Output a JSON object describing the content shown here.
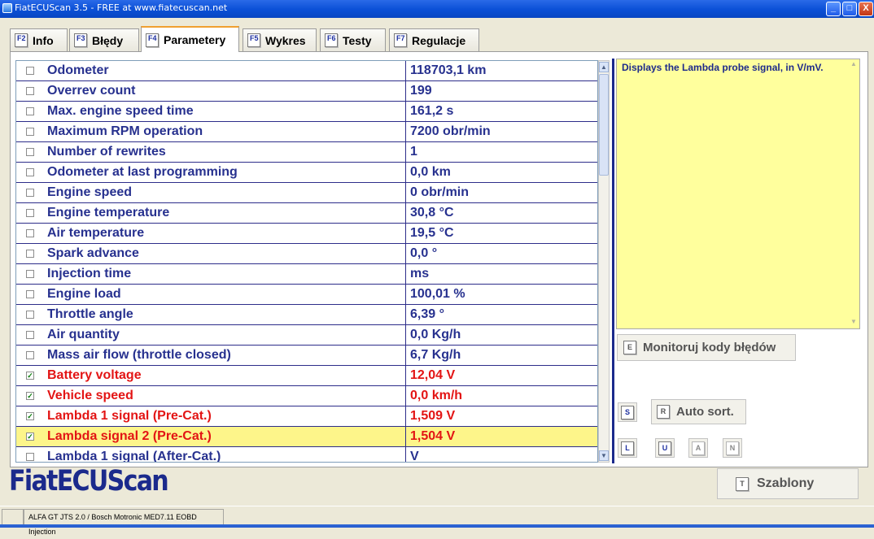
{
  "window": {
    "title": "FiatECUScan 3.5 - FREE at www.fiatecuscan.net",
    "controls": {
      "minimize": "_",
      "maximize": "□",
      "close": "X"
    }
  },
  "tabs": [
    {
      "key": "F2",
      "label": "Info",
      "active": false
    },
    {
      "key": "F3",
      "label": "Błędy",
      "active": false
    },
    {
      "key": "F4",
      "label": "Parametery",
      "active": true
    },
    {
      "key": "F5",
      "label": "Wykres",
      "active": false
    },
    {
      "key": "F6",
      "label": "Testy",
      "active": false
    },
    {
      "key": "F7",
      "label": "Regulacje",
      "active": false
    }
  ],
  "parameters": [
    {
      "name": "Odometer",
      "value": "118703,1 km",
      "checked": false
    },
    {
      "name": "Overrev count",
      "value": "199",
      "checked": false
    },
    {
      "name": "Max. engine speed time",
      "value": "161,2 s",
      "checked": false
    },
    {
      "name": "Maximum RPM operation",
      "value": "7200 obr/min",
      "checked": false
    },
    {
      "name": "Number of rewrites",
      "value": "1",
      "checked": false
    },
    {
      "name": "Odometer at last programming",
      "value": "0,0 km",
      "checked": false
    },
    {
      "name": "Engine speed",
      "value": "0 obr/min",
      "checked": false
    },
    {
      "name": "Engine temperature",
      "value": "30,8 °C",
      "checked": false
    },
    {
      "name": "Air temperature",
      "value": "19,5 °C",
      "checked": false
    },
    {
      "name": "Spark advance",
      "value": "0,0 °",
      "checked": false
    },
    {
      "name": "Injection time",
      "value": " ms",
      "checked": false
    },
    {
      "name": "Engine load",
      "value": "100,01 %",
      "checked": false
    },
    {
      "name": "Throttle angle",
      "value": "6,39 °",
      "checked": false
    },
    {
      "name": "Air quantity",
      "value": "0,0 Kg/h",
      "checked": false
    },
    {
      "name": "Mass air flow (throttle closed)",
      "value": "6,7 Kg/h",
      "checked": false
    },
    {
      "name": "Battery voltage",
      "value": "12,04 V",
      "checked": true
    },
    {
      "name": "Vehicle speed",
      "value": "0,0 km/h",
      "checked": true
    },
    {
      "name": "Lambda 1 signal (Pre-Cat.)",
      "value": "1,509 V",
      "checked": true
    },
    {
      "name": "Lambda signal 2 (Pre-Cat.)",
      "value": "1,504 V",
      "checked": true,
      "highlighted": true
    },
    {
      "name": "Lambda 1 signal (After-Cat.)",
      "value": "V",
      "checked": false
    }
  ],
  "description": "Displays the Lambda probe signal, in V/mV.",
  "buttons": {
    "monitor": {
      "key": "E",
      "label": "Monitoruj kody błędów"
    },
    "select": {
      "key": "S"
    },
    "autosort": {
      "key": "R",
      "label": "Auto sort."
    },
    "log": {
      "key": "L"
    },
    "unselect": {
      "key": "U"
    },
    "all": {
      "key": "A"
    },
    "none": {
      "key": "N"
    },
    "templates": {
      "key": "T",
      "label": "Szablony"
    }
  },
  "logo": "FiatECUScan",
  "status": {
    "vehicle": "ALFA GT JTS 2.0 / Bosch Motronic MED7.11 EOBD Injection"
  },
  "colors": {
    "text_normal": "#27318f",
    "text_selected": "#e31414",
    "highlight_row": "#fdf58a",
    "description_bg": "#ffff9d",
    "logo": "#1b2a8c"
  }
}
